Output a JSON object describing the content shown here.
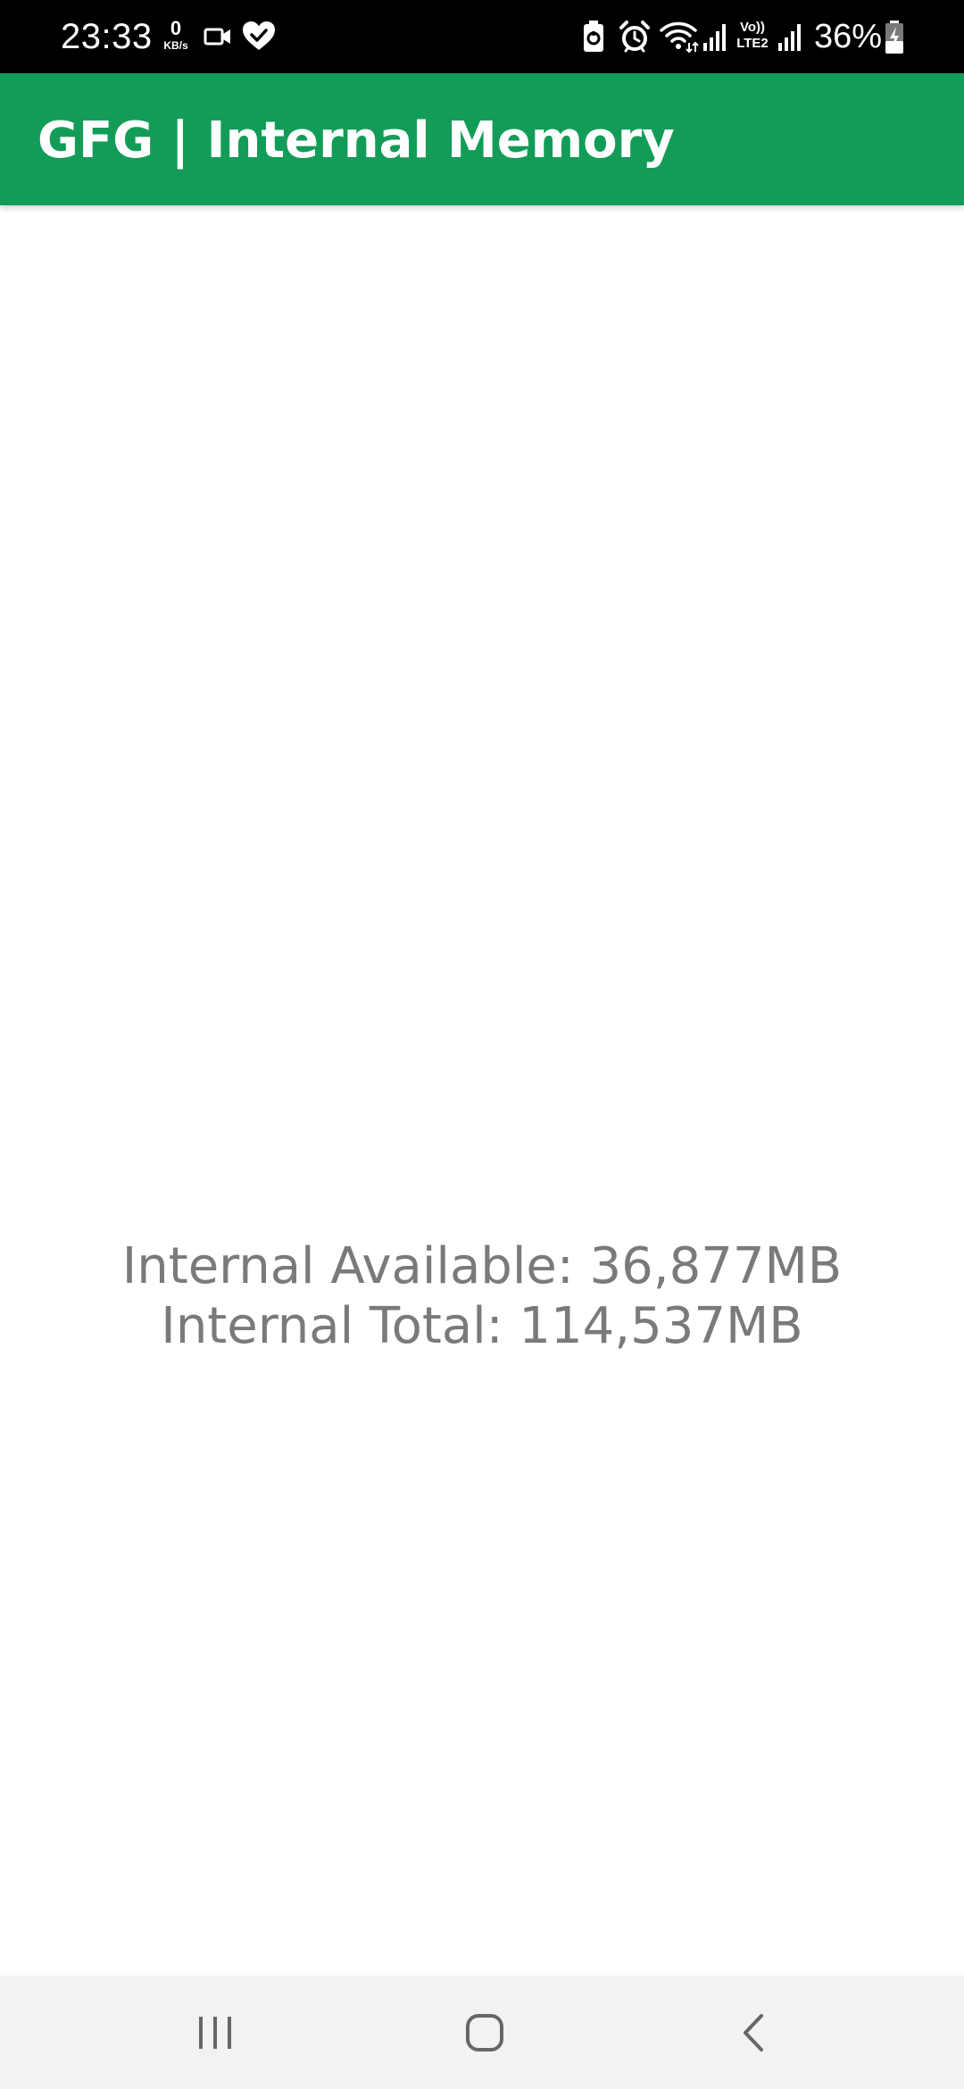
{
  "status_bar": {
    "time": "23:33",
    "net_speed_value": "0",
    "net_speed_unit": "KB/s",
    "lte_label_top": "Vo))",
    "lte_label_bottom": "LTE2",
    "battery_percent": "36%",
    "icons": [
      "video-camera-icon",
      "health-heart-check-icon",
      "battery-saver-icon",
      "alarm-icon",
      "wifi-icon",
      "signal-bars-icon",
      "volte-lte2-icon",
      "signal-bars-icon-2",
      "battery-charging-icon"
    ]
  },
  "app_bar": {
    "title": "GFG | Internal Memory",
    "background_color": "#139c58"
  },
  "main": {
    "internal_available": "Internal Available: 36,877MB",
    "internal_total": "Internal Total: 114,537MB",
    "text_color": "#7a7a7a"
  },
  "nav_bar": {
    "buttons": [
      "recent-apps-icon",
      "home-icon",
      "back-icon"
    ]
  }
}
